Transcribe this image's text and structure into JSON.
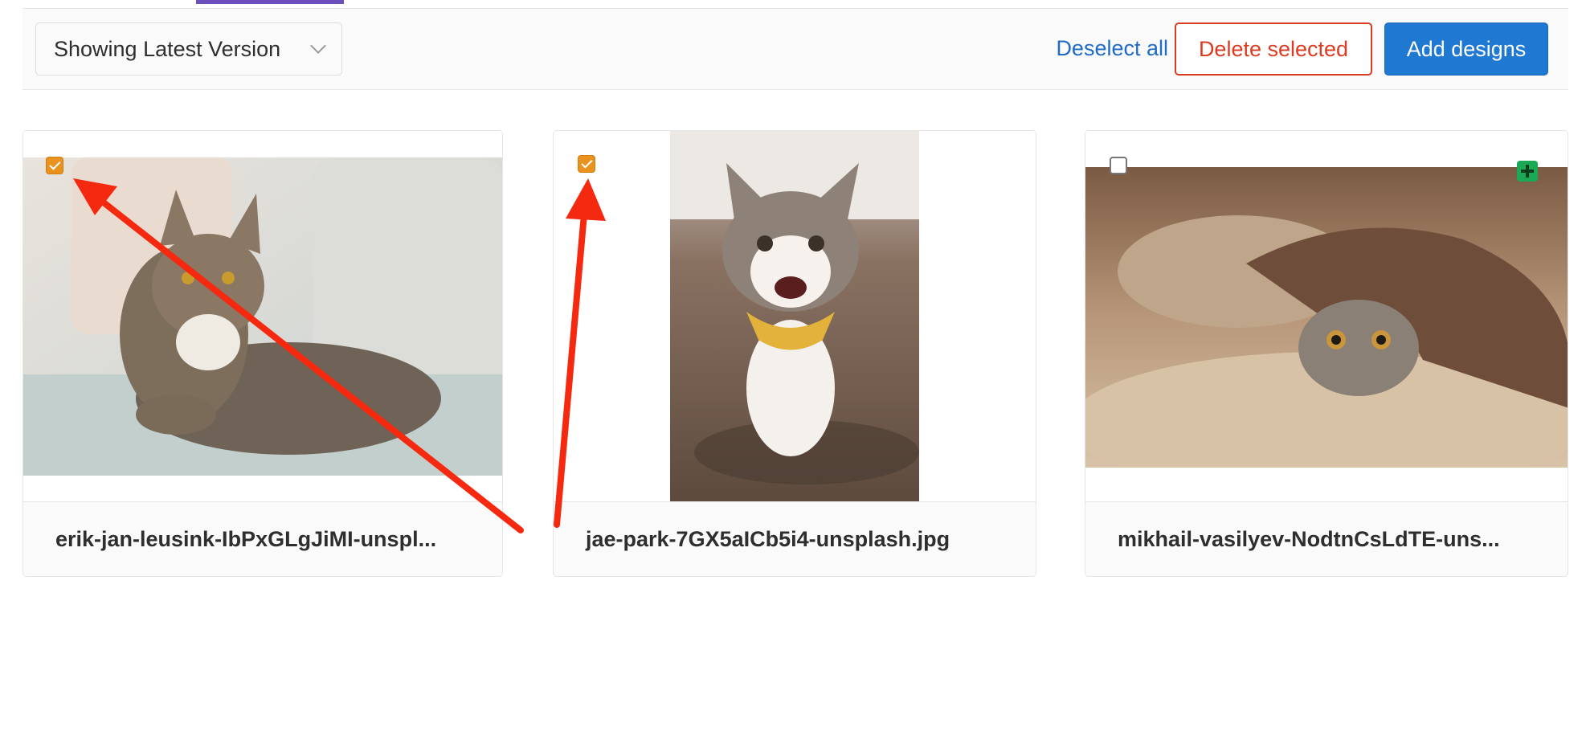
{
  "toolbar": {
    "version_label": "Showing Latest Version",
    "deselect_label": "Deselect all",
    "delete_label": "Delete selected",
    "add_label": "Add designs"
  },
  "designs": [
    {
      "filename": "erik-jan-leusink-IbPxGLgJiMI-unspl...",
      "selected": true
    },
    {
      "filename": "jae-park-7GX5aICb5i4-unsplash.jpg",
      "selected": true
    },
    {
      "filename": "mikhail-vasilyev-NodtnCsLdTE-uns...",
      "selected": false,
      "new_badge": "plus-icon"
    }
  ],
  "colors": {
    "accent": "#1f78d1",
    "danger": "#db3b21",
    "checked": "#e9921e",
    "annotation": "#f5290f",
    "new_badge": "#1aaa55"
  }
}
